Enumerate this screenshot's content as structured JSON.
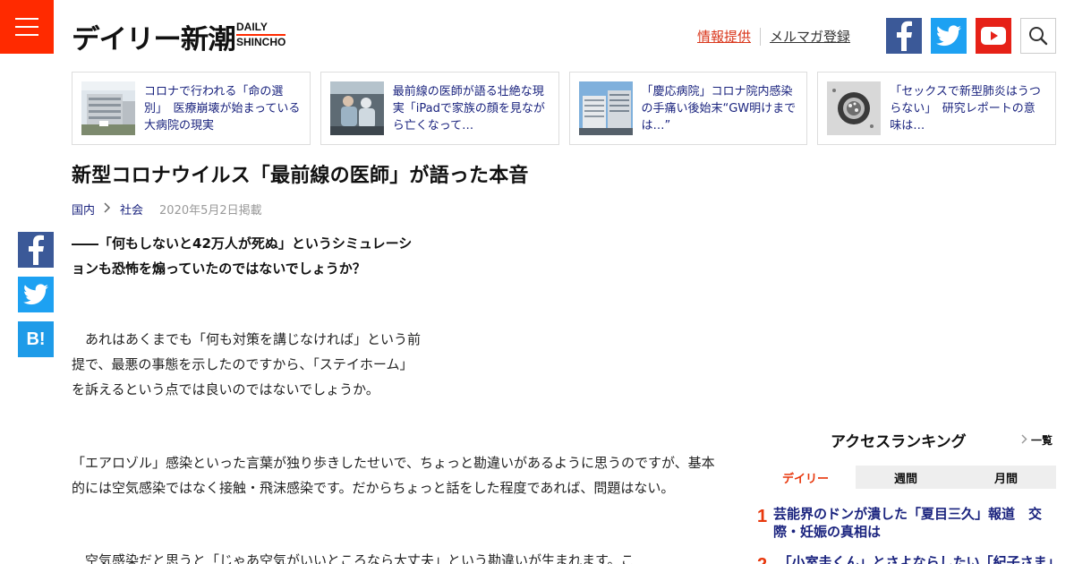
{
  "header": {
    "logo_jp": "デイリー新潮",
    "logo_en_line1": "DAILY",
    "logo_en_line2": "SHINCHO",
    "link_info": "情報提供",
    "link_mail": "メルマガ登録",
    "icons": [
      "menu-icon",
      "facebook-icon",
      "twitter-icon",
      "youtube-icon",
      "search-icon"
    ],
    "colors": {
      "brand": "#ff2a00",
      "facebook": "#3b5998",
      "twitter": "#1da1f2",
      "youtube": "#e62117"
    }
  },
  "related": [
    {
      "text": "コロナで行われる「命の選別」　医療崩壊が始まっている大病院の現実"
    },
    {
      "text": "最前線の医師が語る壮絶な現実「iPadで家族の顔を見ながら亡くなって…"
    },
    {
      "text": "「慶応病院」コロナ院内感染の手痛い後始末“GW明けまでは…”"
    },
    {
      "text": "「セックスで新型肺炎はうつらない」　研究レポートの意味は…"
    }
  ],
  "article": {
    "title": "新型コロナウイルス「最前線の医師」が語った本音",
    "breadcrumb": [
      "国内",
      "社会"
    ],
    "date": "2020年5月2日掲載",
    "question": "――「何もしないと42万人が死ぬ」というシミュレーションも恐怖を煽っていたのではないでしょうか？",
    "paragraphs": [
      "　あれはあくまでも「何も対策を講じなければ」という前提で、最悪の事態を示したのですから、「ステイホーム」を訴えるという点では良いのではないでしょうか。",
      "「エアロゾル」感染といった言葉が独り歩きしたせいで、ちょっと勘違いがあるように思うのですが、基本的には空気感染ではなく接触・飛沫感染です。だからちょっと話をした程度であれば、問題はない。",
      "　空気感染だと思うと「じゃあ空気がいいところなら大丈夫」という勘違いが生まれます。こ"
    ]
  },
  "share": {
    "hatena_label": "B!"
  },
  "ranking": {
    "title": "アクセスランキング",
    "more": "一覧",
    "tabs": [
      "デイリー",
      "週間",
      "月間"
    ],
    "active_tab": "デイリー",
    "items": [
      {
        "num": "1",
        "text": "芸能界のドンが潰した「夏目三久」報道　交際・妊娠の真相は"
      },
      {
        "num": "2",
        "text": "「小室圭くん」とさよならしたい「紀子さま」"
      }
    ]
  }
}
